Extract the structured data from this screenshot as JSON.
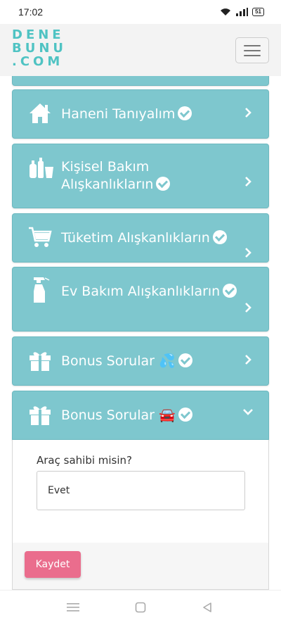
{
  "status_bar": {
    "time": "17:02",
    "battery": "51"
  },
  "header": {
    "logo_lines": [
      "DENE",
      "BUNU",
      ".COM"
    ]
  },
  "sections": [
    {
      "title": "Haneni Tanıyalım",
      "icon": "home-icon",
      "completed": true,
      "expanded": false
    },
    {
      "title": "Kişisel Bakım Alışkanlıkların",
      "icon": "bottles-icon",
      "completed": true,
      "expanded": false
    },
    {
      "title": "Tüketim Alışkanlıkların",
      "icon": "cart-icon",
      "completed": true,
      "expanded": false
    },
    {
      "title": "Ev Bakım Alışkanlıkların",
      "icon": "spray-bottle-icon",
      "completed": true,
      "expanded": false
    },
    {
      "title": "Bonus Sorular",
      "emoji": "💦",
      "icon": "gift-icon",
      "completed": true,
      "expanded": false
    },
    {
      "title": "Bonus Sorular",
      "emoji": "🚘",
      "icon": "gift-icon",
      "completed": true,
      "expanded": true
    }
  ],
  "form": {
    "question": "Araç sahibi misin?",
    "answer": "Evet",
    "save_label": "Kaydet"
  },
  "colors": {
    "card": "#7ec7ce",
    "logo": "#4fc3c3",
    "save_button": "#ea6d8d"
  }
}
